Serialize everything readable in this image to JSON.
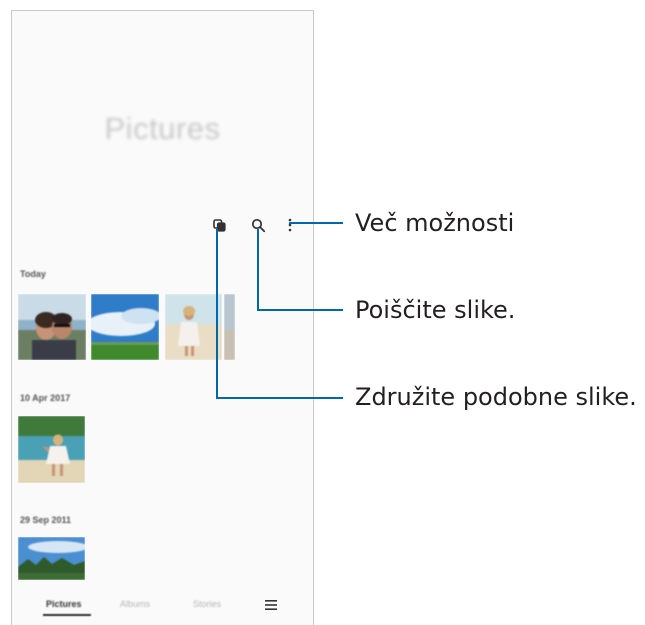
{
  "screen": {
    "title": "Pictures",
    "toolbar": {
      "group_icon": "group-similar-icon",
      "search_icon": "search-icon",
      "more_icon": "more-options-icon"
    },
    "sections": [
      {
        "date": "Today"
      },
      {
        "date": "10 Apr 2017"
      },
      {
        "date": "29 Sep 2011"
      }
    ],
    "bottom_nav": {
      "tabs": [
        "Pictures",
        "Albums",
        "Stories"
      ],
      "active_tab": "Pictures",
      "menu_icon": "menu-icon"
    }
  },
  "callouts": {
    "more_options": "Več možnosti",
    "search": "Poiščite slike.",
    "group_similar": "Združite podobne slike."
  },
  "colors": {
    "callout_line": "#0068a9",
    "callout_text": "#231f20",
    "icon": "#333333"
  }
}
